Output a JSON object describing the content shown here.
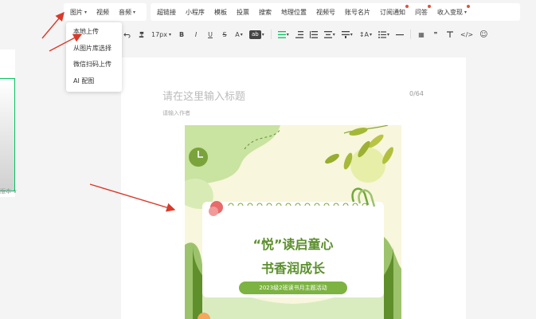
{
  "menubar": {
    "group1": [
      {
        "label": "图片",
        "caret": "▾",
        "dot": false
      },
      {
        "label": "视频",
        "caret": "",
        "dot": false
      },
      {
        "label": "音频",
        "caret": "▾",
        "dot": false
      }
    ],
    "group2": [
      {
        "label": "超链接",
        "dot": false
      },
      {
        "label": "小程序",
        "dot": false
      },
      {
        "label": "模板",
        "dot": false
      },
      {
        "label": "投票",
        "dot": false
      },
      {
        "label": "搜索",
        "dot": false
      },
      {
        "label": "地理位置",
        "dot": false
      },
      {
        "label": "视频号",
        "dot": false
      },
      {
        "label": "账号名片",
        "dot": false
      },
      {
        "label": "订阅通知",
        "dot": true
      },
      {
        "label": "问答",
        "dot": true
      },
      {
        "label": "收入变现",
        "caret": "▾",
        "dot": true
      }
    ]
  },
  "dropdown": {
    "items": [
      "本地上传",
      "从图片库选择",
      "微信扫码上传",
      "AI 配图"
    ]
  },
  "toolbar": {
    "font_size": "17px",
    "font_size_caret": "▾",
    "bold": "B",
    "italic": "I",
    "underline": "U",
    "strike": "S",
    "font_color": "A",
    "bg_color": "ab",
    "caret": "▾",
    "quote": "❞",
    "code": "</>",
    "emoji": "☺",
    "line_spacing": "↕A",
    "table": "▦"
  },
  "left": {
    "label": "版本 ∨"
  },
  "editor": {
    "title_placeholder": "请在这里输入标题",
    "title_count": "0/64",
    "author_placeholder": "请输入作者"
  },
  "poster": {
    "title_line1": "“悦”读启童心",
    "title_line2": "书香润成长",
    "badge": "2023级2班读书月主题活动"
  },
  "colors": {
    "accent": "#07c160",
    "arrow": "#d83b2c",
    "poster_green": "#5b8f2d"
  }
}
